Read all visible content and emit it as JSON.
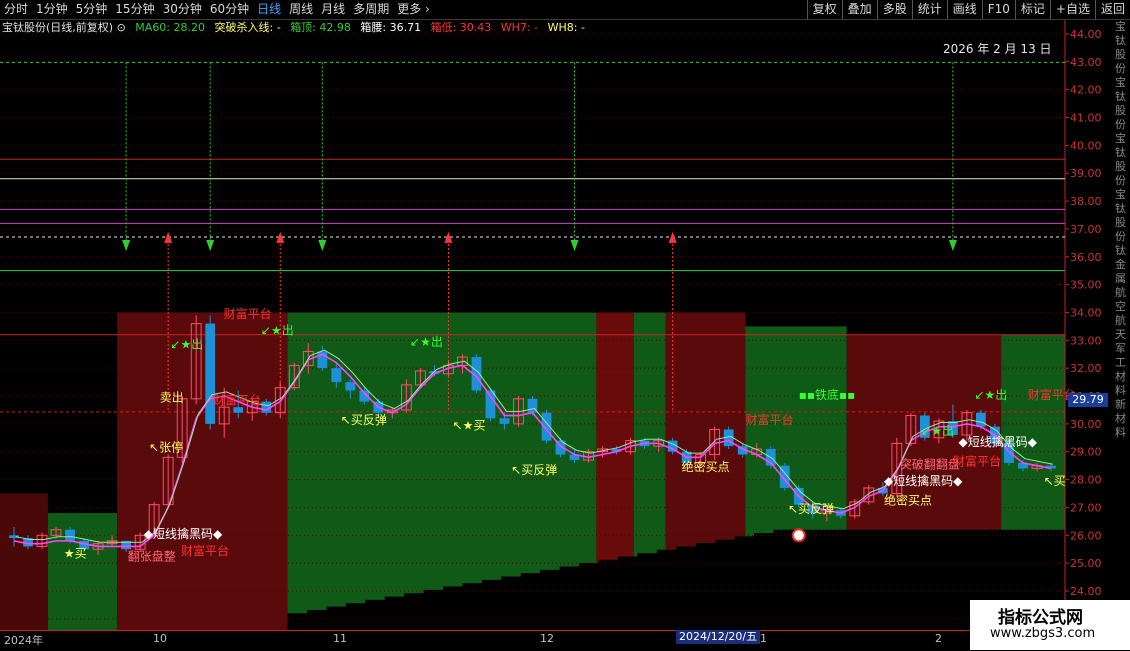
{
  "toolbar": {
    "left_items": [
      "分时",
      "1分钟",
      "5分钟",
      "15分钟",
      "30分钟",
      "60分钟",
      "日线",
      "周线",
      "月线",
      "多周期",
      "更多 ›"
    ],
    "active": "日线",
    "right_buttons": [
      "复权",
      "叠加",
      "多股",
      "统计",
      "画线",
      "F10",
      "标记",
      "+自选",
      "返回"
    ]
  },
  "legend": {
    "title": "宝钛股份(日线,前复权) ⊙",
    "ma60": "MA60: 28.20",
    "tupo": "突破杀入线: -",
    "xiangding": "箱顶: 42.98",
    "xiangyao": "箱腰: 36.71",
    "xiangdi": "箱低: 30.43",
    "wh7": "WH7: -",
    "wh8": "WH8: -"
  },
  "date_label": "2026 年 2 月 13 日",
  "cursor_date": "2024/12/20/五",
  "price_tag": "29.79",
  "x_ticks": [
    "2024年",
    "10",
    "11",
    "12",
    "1",
    "2"
  ],
  "right_strip": "宝钛股份宝钛股份宝钛股份宝钛股份钛金属航空航天军工材料新材料",
  "watermark": {
    "line1": "指标公式网",
    "line2": "www.zbgs3.com"
  },
  "colors": {
    "up": "#ff4d6a",
    "down": "#1e90d8",
    "green_zone": "#0e5a16",
    "red_zone": "#6a0b0b",
    "axis": "#cc2222"
  },
  "chart_data": {
    "type": "candlestick",
    "ylim": [
      22.6,
      44.5
    ],
    "y_ticks": [
      23,
      24,
      25,
      26,
      27,
      28,
      29,
      30,
      31,
      32,
      33,
      34,
      35,
      36,
      37,
      38,
      39,
      40,
      41,
      42,
      43,
      44
    ],
    "candles": [
      [
        26,
        25.6,
        26.3,
        25.9
      ],
      [
        25.9,
        25.5,
        26,
        25.6
      ],
      [
        25.6,
        25.5,
        26.1,
        26
      ],
      [
        26,
        25.9,
        26.3,
        26.2
      ],
      [
        26.2,
        25.7,
        26.3,
        25.8
      ],
      [
        25.8,
        25.4,
        25.9,
        25.5
      ],
      [
        25.5,
        25.3,
        25.8,
        25.7
      ],
      [
        25.7,
        25.6,
        26,
        25.8
      ],
      [
        25.8,
        25.4,
        25.8,
        25.5
      ],
      [
        25.5,
        25.4,
        26.1,
        26
      ],
      [
        26,
        26,
        27.2,
        27.1
      ],
      [
        27.1,
        27,
        28.9,
        28.8
      ],
      [
        28.8,
        28.6,
        31,
        30.9
      ],
      [
        30.9,
        30.7,
        33.9,
        33.6
      ],
      [
        33.6,
        29.8,
        33.9,
        30
      ],
      [
        30,
        29.5,
        31.3,
        30.6
      ],
      [
        30.6,
        30.2,
        31.2,
        30.4
      ],
      [
        30.4,
        30.1,
        30.9,
        30.8
      ],
      [
        30.8,
        30.3,
        30.9,
        30.4
      ],
      [
        30.4,
        30.2,
        31.5,
        31.3
      ],
      [
        31.3,
        31.2,
        32.2,
        32.1
      ],
      [
        32.1,
        31.8,
        32.9,
        32.6
      ],
      [
        32.6,
        31.9,
        32.8,
        32
      ],
      [
        32,
        31.3,
        32.2,
        31.5
      ],
      [
        31.5,
        30.9,
        31.6,
        31.2
      ],
      [
        31.2,
        30.7,
        31.3,
        30.8
      ],
      [
        30.8,
        30.3,
        30.9,
        30.4
      ],
      [
        30.4,
        30.2,
        30.6,
        30.5
      ],
      [
        30.5,
        30.4,
        31.6,
        31.4
      ],
      [
        31.4,
        31.3,
        32,
        31.9
      ],
      [
        31.9,
        31.7,
        32.1,
        31.8
      ],
      [
        31.8,
        31.7,
        32.3,
        32.1
      ],
      [
        32.1,
        31.8,
        32.5,
        32.4
      ],
      [
        32.4,
        31.1,
        32.5,
        31.2
      ],
      [
        31.2,
        30.1,
        31.3,
        30.2
      ],
      [
        30.2,
        29.8,
        30.4,
        30
      ],
      [
        30,
        29.9,
        31,
        30.9
      ],
      [
        30.9,
        30.3,
        31,
        30.4
      ],
      [
        30.4,
        29.3,
        30.5,
        29.4
      ],
      [
        29.4,
        28.8,
        29.5,
        28.9
      ],
      [
        28.9,
        28.6,
        29.1,
        28.7
      ],
      [
        28.7,
        28.6,
        29.1,
        29
      ],
      [
        29,
        28.8,
        29.2,
        29.1
      ],
      [
        29.1,
        28.9,
        29.2,
        29
      ],
      [
        29,
        28.9,
        29.5,
        29.4
      ],
      [
        29.4,
        29.1,
        29.5,
        29.2
      ],
      [
        29.2,
        29,
        29.5,
        29.4
      ],
      [
        29.4,
        28.9,
        29.5,
        29
      ],
      [
        29,
        28.5,
        29.1,
        28.6
      ],
      [
        28.6,
        28.4,
        29,
        28.9
      ],
      [
        28.9,
        28.7,
        29.9,
        29.8
      ],
      [
        29.8,
        29.1,
        29.9,
        29.2
      ],
      [
        29.2,
        28.8,
        29.3,
        28.9
      ],
      [
        28.9,
        28.8,
        29.3,
        29.1
      ],
      [
        29.1,
        28.4,
        29.2,
        28.5
      ],
      [
        28.5,
        27.6,
        28.6,
        27.7
      ],
      [
        27.7,
        27,
        27.8,
        27.1
      ],
      [
        27.1,
        26.6,
        27.2,
        26.8
      ],
      [
        26.8,
        26.5,
        27.1,
        26.9
      ],
      [
        26.9,
        26.6,
        27,
        26.7
      ],
      [
        26.7,
        26.6,
        27.3,
        27.2
      ],
      [
        27.2,
        27.1,
        27.8,
        27.7
      ],
      [
        27.7,
        27.4,
        27.9,
        27.5
      ],
      [
        27.5,
        27.4,
        29.5,
        29.3
      ],
      [
        29.3,
        29.2,
        30.4,
        30.3
      ],
      [
        30.3,
        29.4,
        30.4,
        29.5
      ],
      [
        29.5,
        29.3,
        30.2,
        30.1
      ],
      [
        30.1,
        29.5,
        30.7,
        29.6
      ],
      [
        29.6,
        29.4,
        30.5,
        30.4
      ],
      [
        30.4,
        29.8,
        30.5,
        29.9
      ],
      [
        29.9,
        29.2,
        30,
        29.3
      ],
      [
        29.3,
        28.5,
        29.4,
        28.6
      ],
      [
        28.6,
        28.3,
        28.7,
        28.4
      ],
      [
        28.4,
        28.3,
        28.6,
        28.5
      ],
      [
        28.5,
        28.3,
        28.6,
        28.4
      ]
    ],
    "ma_line": [
      25.8,
      25.7,
      25.7,
      25.8,
      25.8,
      25.7,
      25.6,
      25.6,
      25.6,
      25.6,
      26,
      27,
      28.5,
      30.2,
      30.9,
      31,
      30.8,
      30.6,
      30.5,
      30.8,
      31.5,
      32.3,
      32.5,
      32.2,
      31.7,
      31.1,
      30.6,
      30.4,
      30.7,
      31.3,
      31.8,
      32,
      32.1,
      31.7,
      31,
      30.3,
      30.3,
      30.4,
      29.8,
      29.2,
      28.9,
      28.8,
      28.9,
      29,
      29.2,
      29.3,
      29.3,
      29.1,
      28.8,
      28.8,
      29.3,
      29.4,
      29.1,
      28.9,
      28.6,
      28,
      27.4,
      27,
      26.9,
      26.8,
      27,
      27.4,
      27.6,
      28.3,
      29.4,
      29.7,
      29.9,
      29.9,
      30,
      29.9,
      29.6,
      29,
      28.6,
      28.5,
      28.4
    ],
    "h_lines": [
      {
        "y": 42.98,
        "color": "#33cc33",
        "dash": true
      },
      {
        "y": 39.5,
        "color": "#cc2222"
      },
      {
        "y": 38.8,
        "color": "#e8e8c0"
      },
      {
        "y": 37.7,
        "color": "#cc44cc"
      },
      {
        "y": 37.2,
        "color": "#cc44cc"
      },
      {
        "y": 36.71,
        "color": "#e8e8e8",
        "dash": true
      },
      {
        "y": 35.5,
        "color": "#33cc33"
      },
      {
        "y": 33.2,
        "color": "#cc2222"
      },
      {
        "y": 30.43,
        "color": "#cc2222",
        "dash": true
      }
    ],
    "arrows_down": [
      8,
      14,
      22,
      40,
      67
    ],
    "arrows_up": [
      11,
      19,
      31,
      47
    ],
    "annotations": [
      {
        "x": 0.06,
        "y": 25.2,
        "text": "★买",
        "color": "#ffff66"
      },
      {
        "x": 0.12,
        "y": 25.1,
        "text": "翻张盘整",
        "color": "#ff6677"
      },
      {
        "x": 0.135,
        "y": 25.9,
        "text": "◆短线擒黑码◆",
        "color": "#ffffff"
      },
      {
        "x": 0.17,
        "y": 25.3,
        "text": "财富平台",
        "color": "#ff3333"
      },
      {
        "x": 0.14,
        "y": 29.0,
        "text": "↖张停",
        "color": "#ffff66"
      },
      {
        "x": 0.15,
        "y": 30.8,
        "text": "卖出",
        "color": "#ffff66"
      },
      {
        "x": 0.16,
        "y": 32.7,
        "text": "↙★出",
        "color": "#33ff33"
      },
      {
        "x": 0.2,
        "y": 30.7,
        "text": "财富平台",
        "color": "#ff3333"
      },
      {
        "x": 0.21,
        "y": 33.8,
        "text": "财富平台",
        "color": "#ff3333"
      },
      {
        "x": 0.245,
        "y": 33.2,
        "text": "↙★出",
        "color": "#33ff33"
      },
      {
        "x": 0.32,
        "y": 30.0,
        "text": "↖买反弹",
        "color": "#ffff66"
      },
      {
        "x": 0.385,
        "y": 32.8,
        "text": "↙★出",
        "color": "#33ff33"
      },
      {
        "x": 0.425,
        "y": 29.8,
        "text": "↖★买",
        "color": "#ffff66"
      },
      {
        "x": 0.48,
        "y": 28.2,
        "text": "↖买反弹",
        "color": "#ffff66"
      },
      {
        "x": 0.64,
        "y": 28.3,
        "text": "绝密买点",
        "color": "#ffff66"
      },
      {
        "x": 0.7,
        "y": 30.0,
        "text": "财富平台",
        "color": "#ff3333"
      },
      {
        "x": 0.75,
        "y": 30.9,
        "text": "▪▪铁底▪▪",
        "color": "#33ff33"
      },
      {
        "x": 0.74,
        "y": 26.8,
        "text": "↖买反弹",
        "color": "#ffff66"
      },
      {
        "x": 0.83,
        "y": 27.8,
        "text": "◆短线擒黑码◆",
        "color": "#ffffff"
      },
      {
        "x": 0.83,
        "y": 27.1,
        "text": "绝密买点",
        "color": "#ffff66"
      },
      {
        "x": 0.845,
        "y": 28.4,
        "text": "突破翻翻盘",
        "color": "#ff6677"
      },
      {
        "x": 0.865,
        "y": 29.6,
        "text": "↙★出",
        "color": "#33ff33"
      },
      {
        "x": 0.895,
        "y": 28.5,
        "text": "财富平台",
        "color": "#ff3333"
      },
      {
        "x": 0.9,
        "y": 29.2,
        "text": "◆短线擒黑码◆",
        "color": "#ffffff"
      },
      {
        "x": 0.915,
        "y": 30.9,
        "text": "↙★出",
        "color": "#33ff33"
      },
      {
        "x": 0.965,
        "y": 30.9,
        "text": "财富平台",
        "color": "#ff3333"
      },
      {
        "x": 0.98,
        "y": 27.8,
        "text": "↖买",
        "color": "#ffff66"
      }
    ]
  }
}
